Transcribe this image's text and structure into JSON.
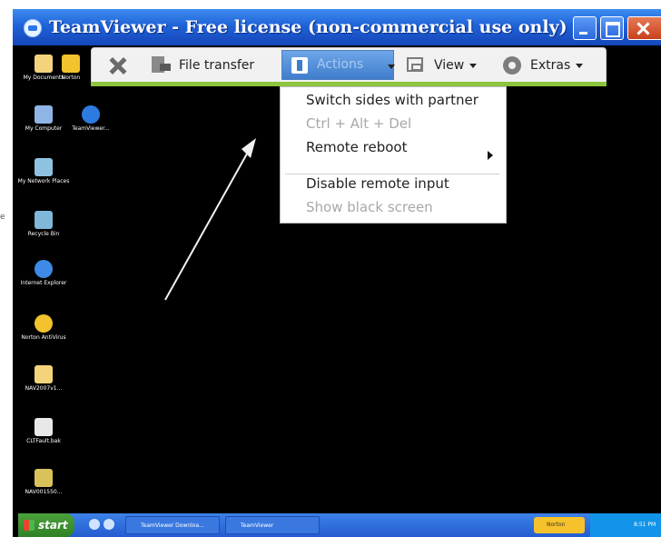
{
  "window": {
    "title": "TeamViewer - Free license (non-commercial use only)"
  },
  "desktop_icons": [
    {
      "label": "My Documents",
      "color": "#f4d47a"
    },
    {
      "label": "Norton",
      "color": "#f2c32c"
    },
    {
      "label": "My Computer",
      "color": "#8fb4e6"
    },
    {
      "label": "TeamViewer...",
      "color": "#2d7be0"
    },
    {
      "label": "My Network Places",
      "color": "#8ec2e0"
    },
    {
      "label": "Recycle Bin",
      "color": "#7fb8d8"
    },
    {
      "label": "Internet Explorer",
      "color": "#3d8be6"
    },
    {
      "label": "Norton AntiVirus",
      "color": "#f2c32c"
    },
    {
      "label": "NAV2007v1...",
      "color": "#f4d47a"
    },
    {
      "label": "CLTFault.bak",
      "color": "#e8e8e8"
    },
    {
      "label": "NAV001550...",
      "color": "#d9c25a"
    }
  ],
  "toolbar": {
    "file_transfer": "File transfer",
    "actions": "Actions",
    "view": "View",
    "extras": "Extras"
  },
  "actions_menu": {
    "items": [
      {
        "label": "Switch sides with partner",
        "enabled": true
      },
      {
        "label": "Ctrl + Alt + Del",
        "enabled": false
      },
      {
        "label": "Remote reboot",
        "enabled": true,
        "submenu": true
      },
      {
        "label": "Disable remote input",
        "enabled": true
      },
      {
        "label": "Show black screen",
        "enabled": false
      }
    ]
  },
  "taskbar": {
    "start": "start",
    "tasks": [
      "TeamViewer Downloa...",
      "TeamViewer"
    ],
    "norton": "Norton",
    "clock": "8:51 PM"
  },
  "colors": {
    "titlebar": "#1f63d8",
    "toolbar_accent": "#8cc63f",
    "actions_highlight": "#3f7dcc",
    "taskbar": "#245cd0"
  }
}
